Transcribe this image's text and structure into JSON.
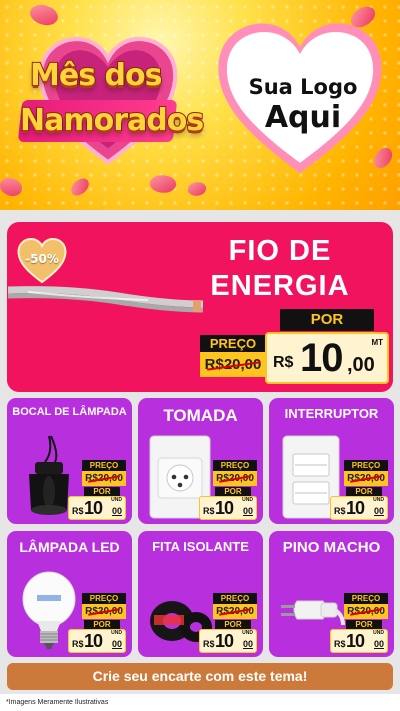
{
  "header": {
    "title_line1": "Mês dos",
    "title_line2": "Namorados",
    "logo_line1": "Sua Logo",
    "logo_line2": "Aqui"
  },
  "featured": {
    "title": "FIO DE ENERGIA",
    "badge": "-50%",
    "old_price_label": "PREÇO",
    "old_price": "R$20,00",
    "new_price_label": "POR",
    "currency": "R$",
    "price_int": "10",
    "price_cents": ",00",
    "unit": "MT"
  },
  "products": [
    {
      "name": "BOCAL DE LÂMPADA",
      "icon": "lamp-socket-icon",
      "old_label": "PREÇO",
      "old_price": "R$20,00",
      "por": "POR",
      "currency": "R$",
      "price_int": "10",
      "price_cents": "00",
      "unit": "UND"
    },
    {
      "name": "TOMADA",
      "icon": "power-outlet-icon",
      "old_label": "PREÇO",
      "old_price": "R$20,00",
      "por": "POR",
      "currency": "R$",
      "price_int": "10",
      "price_cents": "00",
      "unit": "UND"
    },
    {
      "name": "INTERRUPTOR",
      "icon": "light-switch-icon",
      "old_label": "PREÇO",
      "old_price": "R$20,00",
      "por": "POR",
      "currency": "R$",
      "price_int": "10",
      "price_cents": "00",
      "unit": "UND"
    },
    {
      "name": "LÂMPADA LED",
      "icon": "led-bulb-icon",
      "old_label": "PREÇO",
      "old_price": "R$20,00",
      "por": "POR",
      "currency": "R$",
      "price_int": "10",
      "price_cents": "00",
      "unit": "UND"
    },
    {
      "name": "FITA ISOLANTE",
      "icon": "insulating-tape-icon",
      "old_label": "PREÇO",
      "old_price": "R$20,00",
      "por": "POR",
      "currency": "R$",
      "price_int": "10",
      "price_cents": "00",
      "unit": "UND"
    },
    {
      "name": "PINO MACHO",
      "icon": "plug-icon",
      "old_label": "PREÇO",
      "old_price": "R$20,00",
      "por": "POR",
      "currency": "R$",
      "price_int": "10",
      "price_cents": "00",
      "unit": "UND"
    }
  ],
  "cta": "Crie seu encarte com este tema!",
  "footer_note": "*Imagens Meramente Ilustrativas",
  "colors": {
    "header_yellow": "#ffcc1f",
    "featured_pink": "#f2135f",
    "card_purple": "#b82fde",
    "price_yellow": "#ffc51e",
    "cta_brown": "#cc7a3c"
  }
}
